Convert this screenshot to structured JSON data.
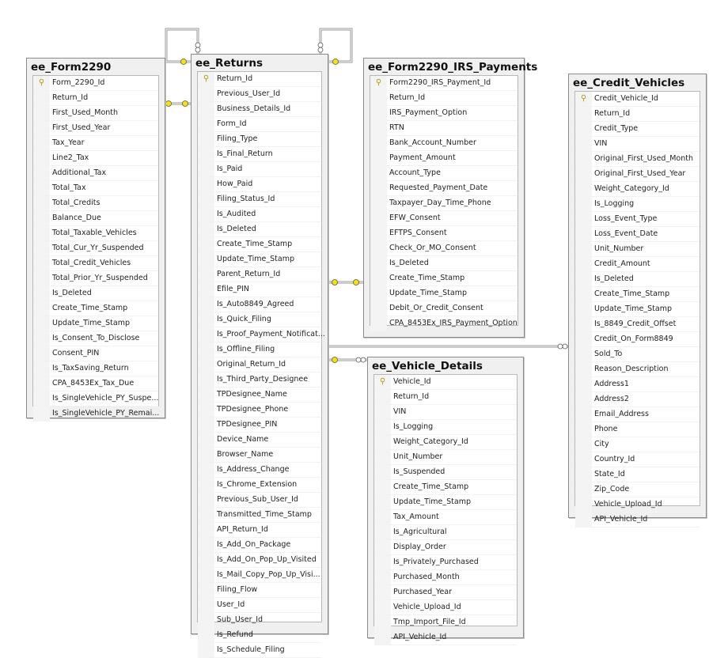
{
  "tables": [
    {
      "name": "ee_Form2290",
      "primary_key": "Form_2290_Id",
      "columns": [
        "Form_2290_Id",
        "Return_Id",
        "First_Used_Month",
        "First_Used_Year",
        "Tax_Year",
        "Line2_Tax",
        "Additional_Tax",
        "Total_Tax",
        "Total_Credits",
        "Balance_Due",
        "Total_Taxable_Vehicles",
        "Total_Cur_Yr_Suspended",
        "Total_Credit_Vehicles",
        "Total_Prior_Yr_Suspended",
        "Is_Deleted",
        "Create_Time_Stamp",
        "Update_Time_Stamp",
        "Is_Consent_To_Disclose",
        "Consent_PIN",
        "Is_TaxSaving_Return",
        "CPA_8453Ex_Tax_Due",
        "Is_SingleVehicle_PY_Suspe...",
        "Is_SingleVehicle_PY_Remai..."
      ]
    },
    {
      "name": "ee_Returns",
      "primary_key": "Return_Id",
      "columns": [
        "Return_Id",
        "Previous_User_Id",
        "Business_Details_Id",
        "Form_Id",
        "Filing_Type",
        "Is_Final_Return",
        "Is_Paid",
        "How_Paid",
        "Filing_Status_Id",
        "Is_Audited",
        "Is_Deleted",
        "Create_Time_Stamp",
        "Update_Time_Stamp",
        "Parent_Return_Id",
        "Efile_PIN",
        "Is_Auto8849_Agreed",
        "Is_Quick_Filing",
        "Is_Proof_Payment_Notificat...",
        "Is_Offline_Filing",
        "Original_Return_Id",
        "Is_Third_Party_Designee",
        "TPDesignee_Name",
        "TPDesignee_Phone",
        "TPDesignee_PIN",
        "Device_Name",
        "Browser_Name",
        "Is_Address_Change",
        "Is_Chrome_Extension",
        "Previous_Sub_User_Id",
        "Transmitted_Time_Stamp",
        "API_Return_Id",
        "Is_Add_On_Package",
        "Is_Add_On_Pop_Up_Visited",
        "Is_Mail_Copy_Pop_Up_Visi...",
        "Filing_Flow",
        "User_Id",
        "Sub_User_Id",
        "Is_Refund",
        "Is_Schedule_Filing"
      ]
    },
    {
      "name": "ee_Form2290_IRS_Payments",
      "primary_key": "Form2290_IRS_Payment_Id",
      "columns": [
        "Form2290_IRS_Payment_Id",
        "Return_Id",
        "IRS_Payment_Option",
        "RTN",
        "Bank_Account_Number",
        "Payment_Amount",
        "Account_Type",
        "Requested_Payment_Date",
        "Taxpayer_Day_Time_Phone",
        "EFW_Consent",
        "EFTPS_Consent",
        "Check_Or_MO_Consent",
        "Is_Deleted",
        "Create_Time_Stamp",
        "Update_Time_Stamp",
        "Debit_Or_Credit_Consent",
        "CPA_8453Ex_IRS_Payment_Option"
      ]
    },
    {
      "name": "ee_Credit_Vehicles",
      "primary_key": "Credit_Vehicle_Id",
      "columns": [
        "Credit_Vehicle_Id",
        "Return_Id",
        "Credit_Type",
        "VIN",
        "Original_First_Used_Month",
        "Original_First_Used_Year",
        "Weight_Category_Id",
        "Is_Logging",
        "Loss_Event_Type",
        "Loss_Event_Date",
        "Unit_Number",
        "Credit_Amount",
        "Is_Deleted",
        "Create_Time_Stamp",
        "Update_Time_Stamp",
        "Is_8849_Credit_Offset",
        "Credit_On_Form8849",
        "Sold_To",
        "Reason_Description",
        "Address1",
        "Address2",
        "Email_Address",
        "Phone",
        "City",
        "Country_Id",
        "State_Id",
        "Zip_Code",
        "Vehicle_Upload_Id",
        "API_Vehicle_Id"
      ]
    },
    {
      "name": "ee_Vehicle_Details",
      "primary_key": "Vehicle_Id",
      "columns": [
        "Vehicle_Id",
        "Return_Id",
        "VIN",
        "Is_Logging",
        "Weight_Category_Id",
        "Unit_Number",
        "Is_Suspended",
        "Create_Time_Stamp",
        "Update_Time_Stamp",
        "Tax_Amount",
        "Is_Agricultural",
        "Display_Order",
        "Is_Privately_Purchased",
        "Purchased_Month",
        "Purchased_Year",
        "Vehicle_Upload_Id",
        "Tmp_Import_File_Id",
        "API_Vehicle_Id"
      ]
    }
  ],
  "relationships": [
    {
      "from": "ee_Returns",
      "to": "ee_Form2290"
    },
    {
      "from": "ee_Returns",
      "to": "ee_Returns"
    },
    {
      "from": "ee_Returns",
      "to": "ee_Returns"
    },
    {
      "from": "ee_Returns",
      "to": "ee_Form2290_IRS_Payments"
    },
    {
      "from": "ee_Returns",
      "to": "ee_Credit_Vehicles"
    },
    {
      "from": "ee_Returns",
      "to": "ee_Vehicle_Details"
    }
  ],
  "colors": {
    "key_icon": "#e8d800",
    "box_border": "#8a8a8a",
    "box_bg": "#f0f0f0"
  }
}
